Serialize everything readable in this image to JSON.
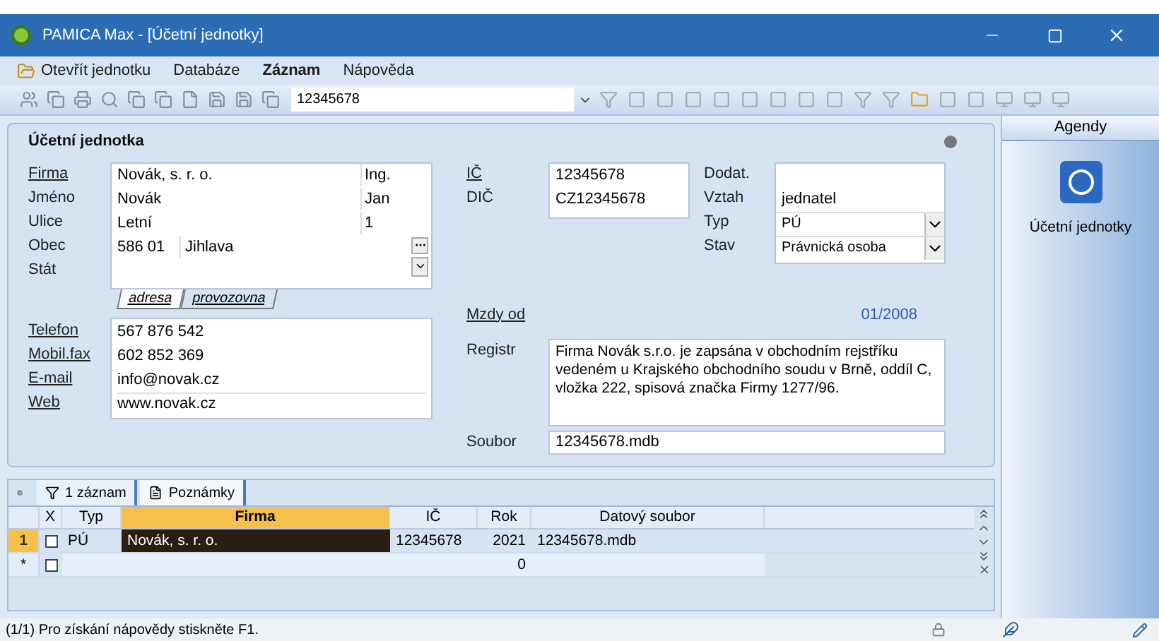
{
  "window": {
    "title": "PAMICA Max - [Účetní jednotky]"
  },
  "menu": [
    {
      "label": "Otevřít jednotku",
      "bold": false
    },
    {
      "label": "Databáze",
      "bold": false
    },
    {
      "label": "Záznam",
      "bold": true
    },
    {
      "label": "Nápověda",
      "bold": false
    }
  ],
  "toolbar": {
    "record_field": {
      "value": "12345678"
    }
  },
  "form": {
    "title": "Účetní jednotka",
    "address": [
      {
        "label": "Firma",
        "link": true,
        "kind": "split",
        "value": "Novák, s. r. o.",
        "value_2": "Ing."
      },
      {
        "label": "Jméno",
        "link": false,
        "kind": "split",
        "value": "Novák",
        "value_2": "Jan"
      },
      {
        "label": "Ulice",
        "link": false,
        "kind": "split",
        "value": "Letní",
        "value_2": "1"
      },
      {
        "label": "Obec",
        "link": false,
        "kind": "zip",
        "value": "586 01",
        "value_2": "Jihlava"
      },
      {
        "label": "Stát",
        "link": false,
        "kind": "empty"
      }
    ],
    "address_tabs": [
      {
        "label": "adresa",
        "selected": true
      },
      {
        "label": "provozovna",
        "selected": false
      }
    ],
    "contacts": [
      {
        "label": "Telefon",
        "link": true,
        "value": "567 876 542"
      },
      {
        "label": "Mobil.fax",
        "link": true,
        "value": "602 852 369"
      },
      {
        "label": "E-mail",
        "link": true,
        "value": "info@novak.cz"
      },
      {
        "label": "Web",
        "link": true,
        "value": "www.novak.cz"
      }
    ],
    "ids": [
      {
        "label": "IČ",
        "link": true,
        "value": "12345678"
      },
      {
        "label": "DIČ",
        "link": false,
        "value": "CZ12345678"
      }
    ],
    "relation": [
      {
        "label": "Dodat.",
        "kind": "text"
      },
      {
        "label": "Vztah",
        "kind": "text",
        "value": "jednatel"
      },
      {
        "label": "Typ",
        "kind": "select",
        "value": "PÚ"
      },
      {
        "label": "Stav",
        "kind": "select",
        "value": "Právnická osoba"
      }
    ],
    "wages": {
      "label": "Mzdy od",
      "link": true,
      "value": "01/2008"
    },
    "register": {
      "label": "Registr",
      "value": "Firma Novák s.r.o. je zapsána v obchodním rejstříku vedeném u Krajského obchodního soudu v Brně, oddíl C, vložka 222, spisová značka Firmy 1277/96."
    },
    "file": {
      "label": "Soubor",
      "value": "12345678.mdb"
    }
  },
  "grid": {
    "tabs": [
      {
        "label": "1 záznam",
        "selected": true
      },
      {
        "label": "Poznámky",
        "selected": false
      }
    ],
    "columns": [
      {
        "label": "X",
        "sorted": false
      },
      {
        "label": "Typ",
        "sorted": false
      },
      {
        "label": "Firma",
        "sorted": true
      },
      {
        "label": "IČ",
        "sorted": false
      },
      {
        "label": "Rok",
        "sorted": false
      },
      {
        "label": "Datový soubor",
        "sorted": false
      }
    ],
    "rows": [
      {
        "marker": "1",
        "selected": true,
        "checked": false,
        "cells": [
          null,
          "PÚ",
          "Novák, s. r. o.",
          "12345678",
          "2021",
          "12345678.mdb"
        ]
      },
      {
        "marker": "*",
        "selected": false,
        "checked": false,
        "cells": [
          null,
          null,
          null,
          null,
          "0",
          null
        ]
      }
    ]
  },
  "sidebar": {
    "title": "Agendy",
    "items": [
      {
        "label": "Účetní jednotky",
        "selected": true
      }
    ]
  },
  "status_bar": {
    "text": "(1/1) Pro získání nápovědy stiskněte F1."
  }
}
